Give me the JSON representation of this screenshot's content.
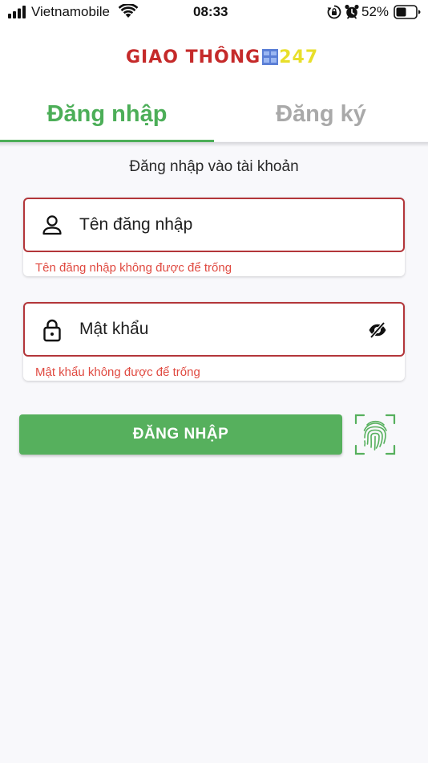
{
  "status_bar": {
    "carrier": "Vietnamobile",
    "time": "08:33",
    "battery_percent": "52%",
    "battery_level": 0.52,
    "icons": [
      "signal-icon",
      "wifi-icon",
      "rotation-lock-icon",
      "alarm-icon",
      "battery-icon"
    ]
  },
  "logo": {
    "text": "GIAO THÔNG",
    "number": "247",
    "text_color": "#c52a2a",
    "number_color": "#e8df2a"
  },
  "tabs": [
    {
      "label": "Đăng nhập",
      "active": true
    },
    {
      "label": "Đăng ký",
      "active": false
    }
  ],
  "form": {
    "subtitle": "Đăng nhập vào tài khoản",
    "username": {
      "placeholder": "Tên đăng nhập",
      "value": "",
      "error": "Tên đăng nhập không được để trống",
      "icon": "person-icon"
    },
    "password": {
      "placeholder": "Mật khẩu",
      "value": "",
      "error": "Mật khẩu không được để trống",
      "icon": "lock-icon",
      "toggle_icon": "eye-off-icon"
    },
    "submit_label": "ĐĂNG NHẬP",
    "fingerprint_icon": "fingerprint-icon"
  },
  "colors": {
    "accent": "#4cae58",
    "button": "#56b05d",
    "error_border": "#b3363a",
    "error_text": "#e04a41",
    "inactive_tab": "#a9a9a9"
  }
}
